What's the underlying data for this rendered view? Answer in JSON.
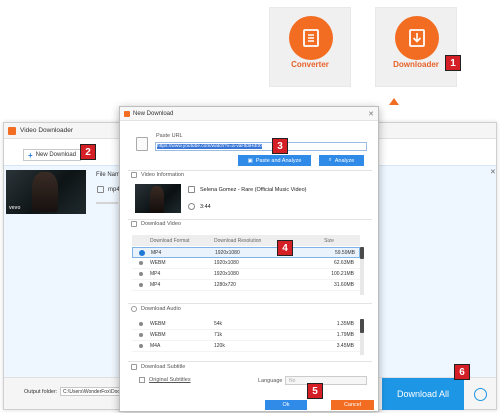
{
  "launcher": {
    "converter_label": "Converter",
    "downloader_label": "Downloader"
  },
  "badges": [
    "1",
    "2",
    "3",
    "4",
    "5",
    "6"
  ],
  "main_window": {
    "title": "Video Downloader",
    "new_download_label": "New Download",
    "file_name_label": "File Name",
    "format_label": "mp4",
    "thumb_brand": "vevo",
    "output_folder_label": "Output folder:",
    "output_folder_value": "C:\\Users\\WonderFox\\Docume",
    "download_all_label": "Download All"
  },
  "dialog": {
    "title": "New Download",
    "paste_url_label": "Paste URL",
    "url_value": "https://www.youtube.com/watch?v=a-vaHtdiHiEI0",
    "paste_analyze_label": "Paste and Analyze",
    "analyze_label": "Analyze",
    "video_info_header": "Video Information",
    "video_title": "Selena Gomez - Rare (Official Music Video)",
    "video_duration": "3:44",
    "download_video_header": "Download Video",
    "video_columns": {
      "format": "Download Format",
      "resolution": "Download Resolution",
      "size": "Size"
    },
    "video_rows": [
      {
        "format": "MP4",
        "resolution": "1920x1080",
        "size": "59.59MB",
        "selected": true
      },
      {
        "format": "WEBM",
        "resolution": "1920x1080",
        "size": "62.63MB",
        "selected": false
      },
      {
        "format": "MP4",
        "resolution": "1920x1080",
        "size": "100.21MB",
        "selected": false
      },
      {
        "format": "MP4",
        "resolution": "1280x720",
        "size": "31.60MB",
        "selected": false
      }
    ],
    "download_audio_header": "Download Audio",
    "audio_rows": [
      {
        "format": "WEBM",
        "bitrate": "54k",
        "size": "1.35MB"
      },
      {
        "format": "WEBM",
        "bitrate": "71k",
        "size": "1.79MB"
      },
      {
        "format": "M4A",
        "bitrate": "120k",
        "size": "3.45MB"
      }
    ],
    "download_subtitle_header": "Download Subtitle",
    "original_subtitles_label": "Original Subtitles",
    "language_label": "Language",
    "language_value": "No",
    "ok_label": "Ok",
    "cancel_label": "Cancel"
  },
  "colors": {
    "accent_orange": "#f26d21",
    "accent_blue": "#1e96e6",
    "badge_red": "#d41f27"
  }
}
